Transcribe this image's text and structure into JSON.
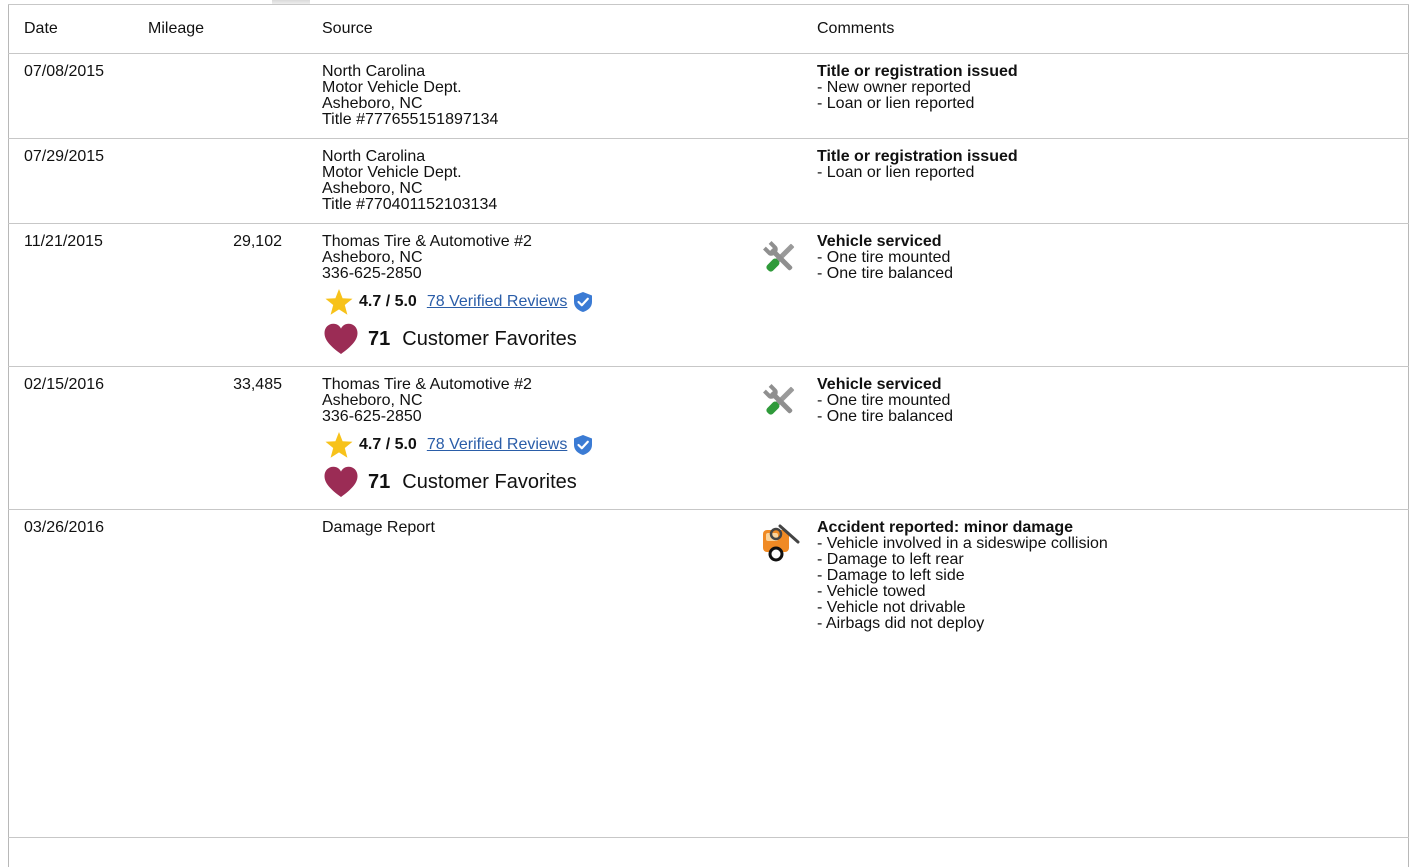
{
  "header": {
    "date": "Date",
    "mileage": "Mileage",
    "source": "Source",
    "comments": "Comments"
  },
  "rows": [
    {
      "date": "07/08/2015",
      "mileage": "",
      "source": [
        "North Carolina",
        "Motor Vehicle Dept.",
        "Asheboro, NC",
        "Title #777655151897134"
      ],
      "icon": "",
      "comment_title": "Title or registration issued",
      "comments": [
        "- New owner reported",
        "- Loan or lien reported"
      ]
    },
    {
      "date": "07/29/2015",
      "mileage": "",
      "source": [
        "North Carolina",
        "Motor Vehicle Dept.",
        "Asheboro, NC",
        "Title #770401152103134"
      ],
      "icon": "",
      "comment_title": "Title or registration issued",
      "comments": [
        "- Loan or lien reported"
      ]
    },
    {
      "date": "11/21/2015",
      "mileage": "29,102",
      "source": [
        "Thomas Tire & Automotive #2",
        "Asheboro, NC",
        "336-625-2850"
      ],
      "rating": "4.7 / 5.0",
      "reviews": "78 Verified Reviews",
      "favorites_count": "71",
      "favorites_label": "Customer Favorites",
      "icon": "wrench-screwdriver-icon",
      "comment_title": "Vehicle serviced",
      "comments": [
        "- One tire mounted",
        "- One tire balanced"
      ]
    },
    {
      "date": "02/15/2016",
      "mileage": "33,485",
      "source": [
        "Thomas Tire & Automotive #2",
        "Asheboro, NC",
        "336-625-2850"
      ],
      "rating": "4.7 / 5.0",
      "reviews": "78 Verified Reviews",
      "favorites_count": "71",
      "favorites_label": "Customer Favorites",
      "icon": "wrench-screwdriver-icon",
      "comment_title": "Vehicle serviced",
      "comments": [
        "- One tire mounted",
        "- One tire balanced"
      ]
    },
    {
      "date": "03/26/2016",
      "mileage": "",
      "source": [
        "Damage Report"
      ],
      "icon": "accident-car-icon",
      "comment_title": "Accident reported: minor damage",
      "comments": [
        "- Vehicle involved in a sideswipe collision",
        "- Damage to left rear",
        "- Damage to left side",
        "- Vehicle towed",
        "- Vehicle not drivable",
        "- Airbags did not deploy"
      ]
    }
  ],
  "colors": {
    "link": "#2a5da8",
    "star": "#f7c21a",
    "heart": "#9b2c55",
    "shield": "#3b7bd4",
    "border": "#c7c7c7"
  }
}
